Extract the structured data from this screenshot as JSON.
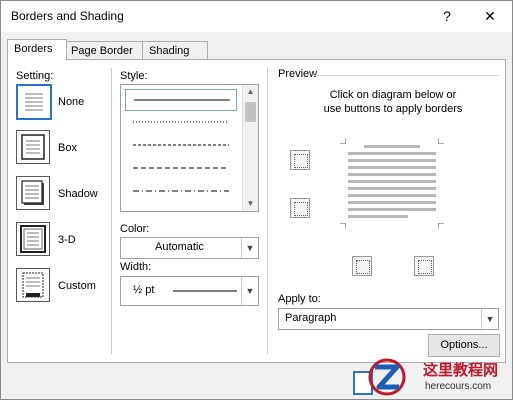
{
  "window": {
    "title": "Borders and Shading",
    "help_glyph": "?",
    "close_glyph": "✕"
  },
  "tabs": [
    {
      "label": "Borders"
    },
    {
      "label": "Page Border"
    },
    {
      "label": "Shading"
    }
  ],
  "setting": {
    "label": "Setting:",
    "items": [
      {
        "label": "None"
      },
      {
        "label": "Box"
      },
      {
        "label": "Shadow"
      },
      {
        "label": "3-D"
      },
      {
        "label": "Custom"
      }
    ],
    "selected": "None"
  },
  "style": {
    "label": "Style:"
  },
  "color": {
    "label": "Color:",
    "value": "Automatic"
  },
  "width": {
    "label": "Width:",
    "value": "½ pt"
  },
  "preview": {
    "label": "Preview",
    "instructions_line1": "Click on diagram below or",
    "instructions_line2": "use buttons to apply borders"
  },
  "apply_to": {
    "label": "Apply to:",
    "value": "Paragraph"
  },
  "options_button": {
    "label": "Options..."
  },
  "watermark": {
    "brand_cn": "这里教程网",
    "brand_url": "herecours.com"
  },
  "colors": {
    "accent": "#2a72c8",
    "watermark_red": "#c0182b",
    "watermark_blue": "#1a5fb4"
  }
}
